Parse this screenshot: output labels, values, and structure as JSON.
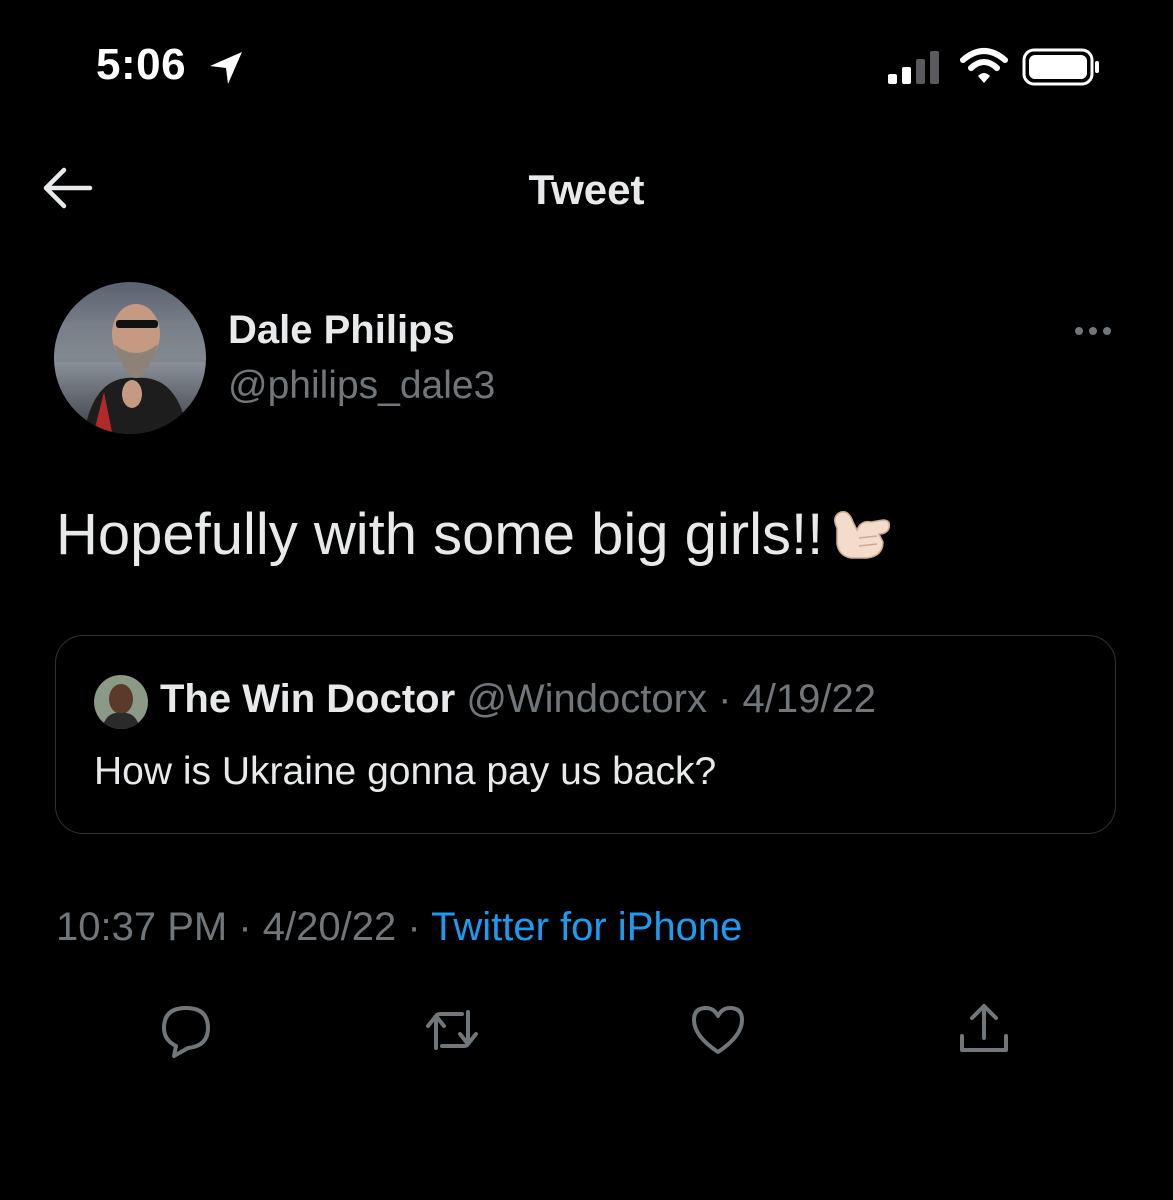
{
  "status_bar": {
    "time": "5:06"
  },
  "header": {
    "title": "Tweet"
  },
  "tweet": {
    "author_name": "Dale Philips",
    "author_handle": "@philips_dale3",
    "text": "Hopefully with some big girls!!",
    "timestamp_time": "10:37 PM",
    "separator": "·",
    "timestamp_date": "4/20/22",
    "source": "Twitter for iPhone"
  },
  "quote": {
    "author_name": "The Win Doctor",
    "author_handle": "@Windoctorx",
    "date": "4/19/22",
    "text": "How is Ukraine gonna pay us back?"
  },
  "colors": {
    "background": "#000000",
    "text_primary": "#e7e9ea",
    "text_secondary": "#71767b",
    "accent": "#1d9bf0",
    "border": "#2f3336"
  },
  "icons": {
    "status": [
      "location-arrow-icon",
      "signal-icon",
      "wifi-icon",
      "battery-icon"
    ],
    "header": [
      "back-arrow-icon"
    ],
    "tweet": [
      "more-icon",
      "call-me-hand-emoji"
    ],
    "actions": [
      "reply-icon",
      "retweet-icon",
      "like-icon",
      "share-icon"
    ]
  }
}
